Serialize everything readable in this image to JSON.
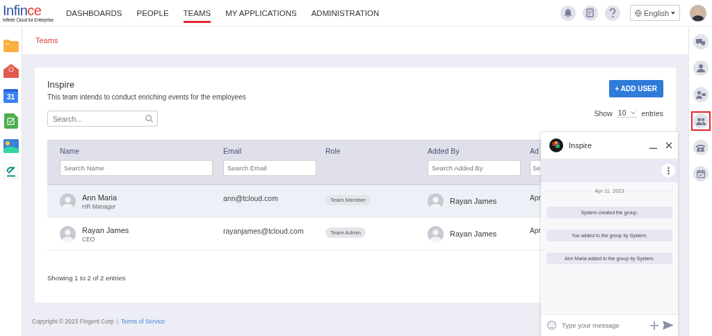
{
  "logo": {
    "parts": [
      "Infin",
      "ce"
    ],
    "tagline": "Infinite Cloud for Enterprise"
  },
  "nav": [
    {
      "label": "DASHBOARDS",
      "selected": false
    },
    {
      "label": "PEOPLE",
      "selected": false
    },
    {
      "label": "TEAMS",
      "selected": true
    },
    {
      "label": "MY APPLICATIONS",
      "selected": false
    },
    {
      "label": "ADMINISTRATION",
      "selected": false
    }
  ],
  "header": {
    "language": "English"
  },
  "left_apps": [
    {
      "kind": "folder"
    },
    {
      "kind": "mail"
    },
    {
      "kind": "calendar",
      "label": "31"
    },
    {
      "kind": "tasks"
    },
    {
      "kind": "gallery"
    },
    {
      "kind": "brand"
    }
  ],
  "right_sidebar": {
    "items": [
      {
        "kind": "chat",
        "selected": false
      },
      {
        "kind": "person",
        "selected": false
      },
      {
        "kind": "contacts",
        "selected": false
      },
      {
        "kind": "group",
        "selected": true
      },
      {
        "kind": "phone",
        "selected": false
      },
      {
        "kind": "calendar",
        "selected": false
      }
    ]
  },
  "breadcrumb": "Teams",
  "team": {
    "title": "Inspire",
    "description": "This team intends to conduct enriching events for the employees",
    "add_button": "+ ADD USER"
  },
  "search": {
    "placeholder": "Search..."
  },
  "page_length": {
    "prefix": "Show",
    "value": "10",
    "suffix": "entries"
  },
  "table": {
    "columns": [
      {
        "label": "Name",
        "filter_placeholder": "Search Name"
      },
      {
        "label": "Email",
        "filter_placeholder": "Search Email"
      },
      {
        "label": "Role"
      },
      {
        "label": "Added By",
        "filter_placeholder": "Search Added By"
      },
      {
        "label": "Ad",
        "filter_placeholder": "Se"
      }
    ],
    "rows": [
      {
        "name": "Ann Maria",
        "title": "HR Manager",
        "email": "ann@tcloud.com",
        "role": "Team Member",
        "added_by": "Rayan James",
        "column_5": "Apr",
        "selected": true
      },
      {
        "name": "Rayan James",
        "title": "CEO",
        "email": "rayanjames@tcloud.com",
        "role": "Team Admin",
        "added_by": "Rayan James",
        "column_5": "Apr",
        "selected": false
      }
    ]
  },
  "table_info": "Showing 1 to 2 of 2 entries",
  "footer": {
    "copyright": "Copyright © 2023 Fingent Corp",
    "separator": "|",
    "link": "Terms of Service"
  },
  "chat": {
    "title": "Inspire",
    "date": "Apr 11, 2023",
    "messages": [
      "System created the group.",
      "You added to the group by System.",
      "Ann Maria added to the group by System."
    ],
    "placeholder": "Type your message"
  }
}
